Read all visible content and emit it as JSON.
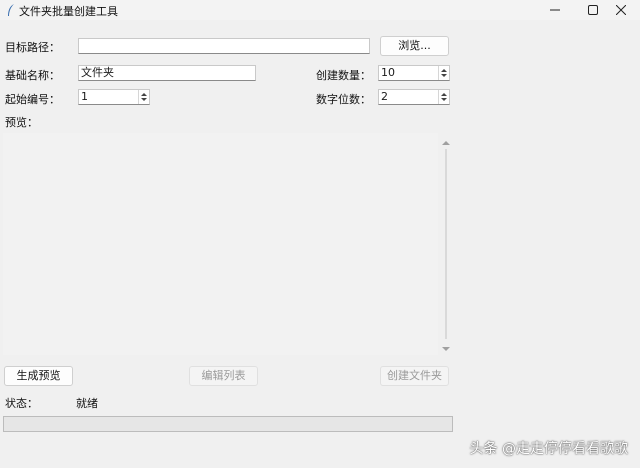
{
  "window": {
    "title": "文件夹批量创建工具",
    "controls": [
      "minimize-icon",
      "maximize-icon",
      "close-icon"
    ]
  },
  "form": {
    "target_path": {
      "label": "目标路径：",
      "value": ""
    },
    "browse_button": "浏览...",
    "base_name": {
      "label": "基础名称：",
      "value": "文件夹"
    },
    "create_count": {
      "label": "创建数量：",
      "value": "10"
    },
    "start_number": {
      "label": "起始编号：",
      "value": "1"
    },
    "digit_count": {
      "label": "数字位数：",
      "value": "2"
    },
    "preview_label": "预览："
  },
  "actions": {
    "generate_preview": "生成预览",
    "edit_list": "编辑列表",
    "create_folders": "创建文件夹"
  },
  "status": {
    "label": "状态：",
    "value": "就绪",
    "progress": 0
  },
  "watermark": "头条 @走走停停看看歌歌",
  "colors": {
    "background": "#f0f0f0",
    "progress_fill": "#06b025",
    "disabled_text": "#9a9a9a"
  }
}
